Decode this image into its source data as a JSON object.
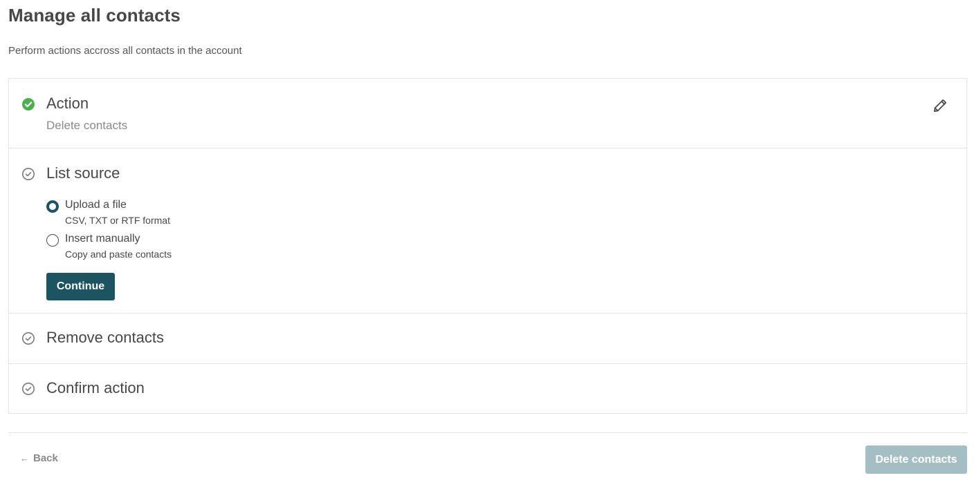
{
  "header": {
    "title": "Manage all contacts",
    "subtitle": "Perform actions accross all contacts in the account"
  },
  "steps": [
    {
      "title": "Action",
      "summary": "Delete contacts",
      "status": "completed",
      "icon": "check-circle-filled-icon"
    },
    {
      "title": "List source",
      "status": "active",
      "icon": "check-circle-outline-icon",
      "options": [
        {
          "label": "Upload a file",
          "description": "CSV, TXT or RTF format",
          "selected": true
        },
        {
          "label": "Insert manually",
          "description": "Copy and paste contacts",
          "selected": false
        }
      ],
      "continue_label": "Continue"
    },
    {
      "title": "Remove contacts",
      "status": "pending",
      "icon": "check-circle-outline-icon"
    },
    {
      "title": "Confirm action",
      "status": "pending",
      "icon": "check-circle-outline-icon"
    }
  ],
  "footer": {
    "back_label": "Back",
    "primary_label": "Delete contacts",
    "primary_disabled": true
  },
  "colors": {
    "accent": "#1c5561",
    "success": "#4caf50",
    "disabled_button": "#a4bfc4"
  }
}
